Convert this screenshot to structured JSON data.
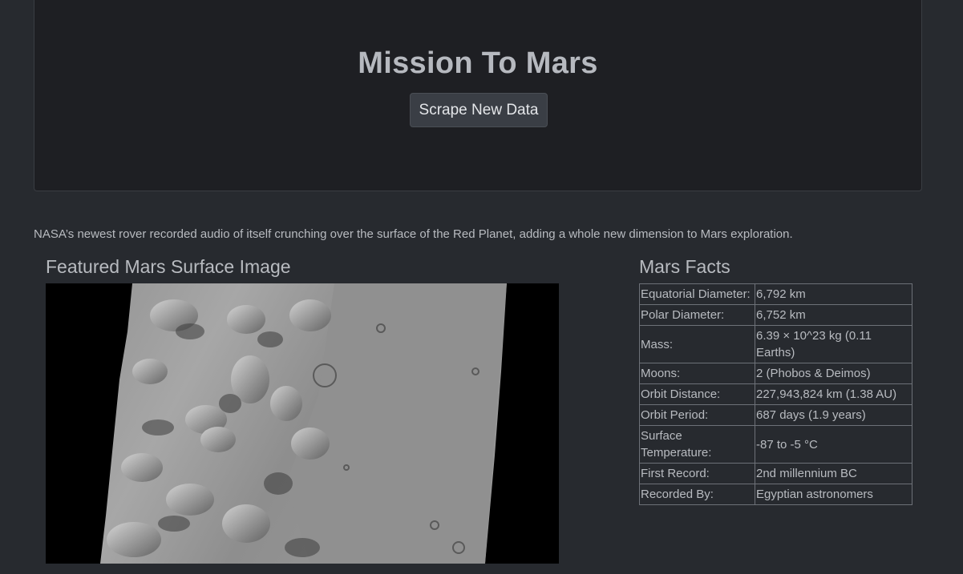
{
  "header": {
    "title": "Mission To Mars",
    "scrape_button": "Scrape New Data"
  },
  "news": {
    "paragraph": "NASA’s newest rover recorded audio of itself crunching over the surface of the Red Planet, adding a whole new dimension to Mars exploration."
  },
  "featured": {
    "heading": "Featured Mars Surface Image"
  },
  "facts": {
    "heading": "Mars Facts",
    "rows": [
      {
        "label": "Equatorial Diameter:",
        "value": "6,792 km"
      },
      {
        "label": "Polar Diameter:",
        "value": "6,752 km"
      },
      {
        "label": "Mass:",
        "value": "6.39 × 10^23 kg (0.11 Earths)"
      },
      {
        "label": "Moons:",
        "value": "2 (Phobos & Deimos)"
      },
      {
        "label": "Orbit Distance:",
        "value": "227,943,824 km (1.38 AU)"
      },
      {
        "label": "Orbit Period:",
        "value": "687 days (1.9 years)"
      },
      {
        "label": "Surface Temperature:",
        "value": "-87 to -5 °C"
      },
      {
        "label": "First Record:",
        "value": "2nd millennium BC"
      },
      {
        "label": "Recorded By:",
        "value": "Egyptian astronomers"
      }
    ]
  }
}
